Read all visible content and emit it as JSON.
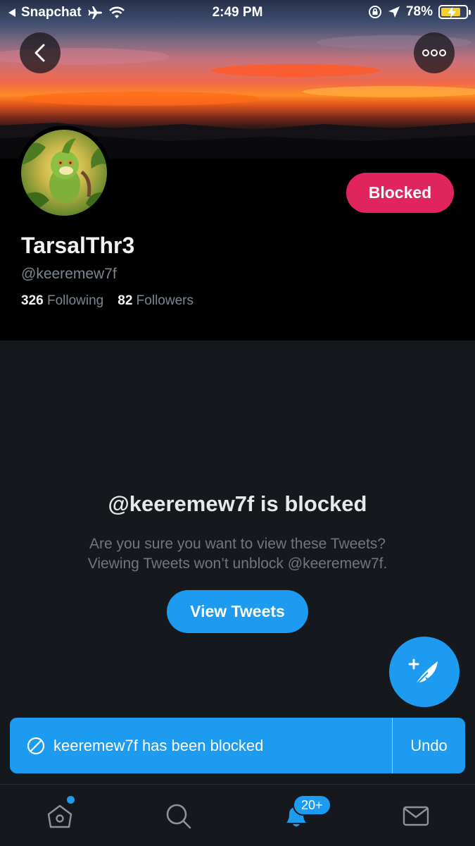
{
  "status_bar": {
    "back_app": "Snapchat",
    "time": "2:49 PM",
    "battery": "78%"
  },
  "profile": {
    "display_name": "TarsalThr3",
    "handle": "@keeremew7f",
    "following_count": "326",
    "following_label": "Following",
    "followers_count": "82",
    "followers_label": "Followers",
    "blocked_button": "Blocked"
  },
  "blocked_notice": {
    "title": "@keeremew7f is blocked",
    "line1": "Are you sure you want to view these Tweets?",
    "line2": "Viewing Tweets won’t unblock @keeremew7f.",
    "view_button": "View Tweets"
  },
  "toast": {
    "message": "keeremew7f has been blocked",
    "action": "Undo"
  },
  "tab_bar": {
    "notifications_badge": "20+",
    "icons": [
      "home-icon",
      "search-icon",
      "notifications-icon",
      "messages-icon"
    ]
  },
  "colors": {
    "accent": "#1d9bf0",
    "blocked": "#e0245e",
    "background": "#15181c"
  }
}
